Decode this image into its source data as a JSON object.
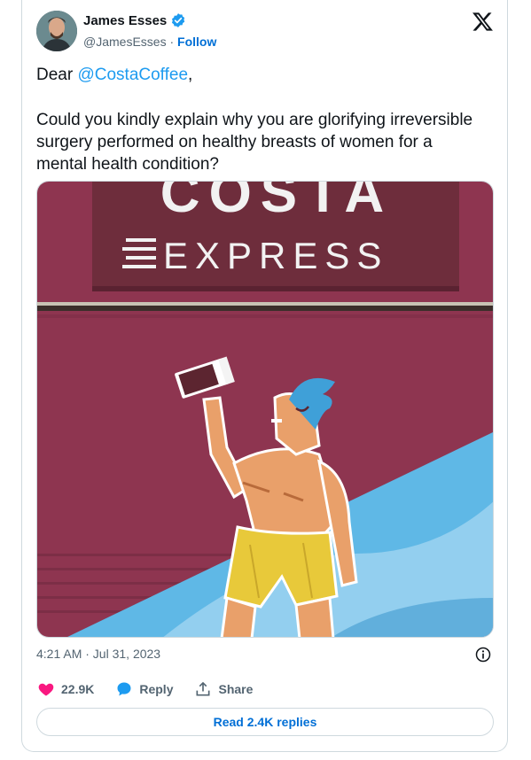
{
  "author": {
    "name": "James Esses",
    "handle": "@JamesEsses",
    "separator": " · ",
    "follow_label": "Follow",
    "verified_color": "#1d9bf0"
  },
  "tweet": {
    "greeting_prefix": "Dear ",
    "mention": "@CostaCoffee",
    "greeting_suffix": ",",
    "body": "Could you kindly explain why you are glorifying irreversible surgery performed on healthy breasts of women for a mental health condition?"
  },
  "media": {
    "sign_top_text": "COSTA",
    "sign_text": "EXPRESS",
    "colors": {
      "van": "#8e3550",
      "sign": "#6e2d3c",
      "skin": "#e9a06a",
      "shorts": "#e8c93a",
      "hair": "#3fa0d8",
      "wave": "#5fb8e6"
    }
  },
  "timestamp": "4:21 AM · Jul 31, 2023",
  "actions": {
    "likes": "22.9K",
    "reply_label": "Reply",
    "share_label": "Share",
    "like_color": "#f91880",
    "reply_color": "#1d9bf0"
  },
  "read_replies_label": "Read 2.4K replies"
}
